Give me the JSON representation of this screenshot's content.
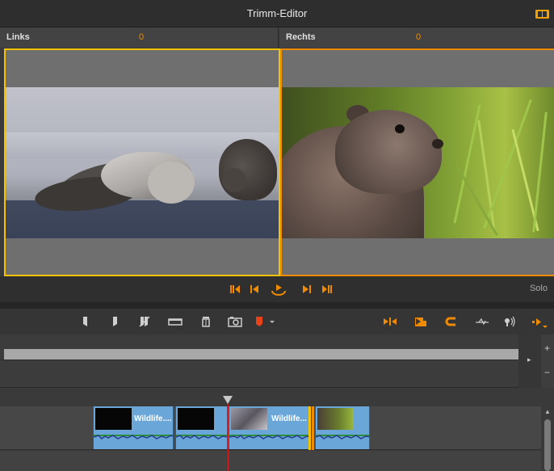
{
  "window": {
    "title": "Trimm-Editor"
  },
  "left_panel": {
    "label": "Links",
    "value": "0"
  },
  "right_panel": {
    "label": "Rechts",
    "value": "0"
  },
  "transport": {
    "solo_label": "Solo"
  },
  "timeline": {
    "clips": [
      {
        "name": "Wildlife...."
      },
      {
        "name": ""
      },
      {
        "name": "Wildlife..."
      },
      {
        "name": ""
      }
    ]
  },
  "scrubber": {
    "plus": "+",
    "minus": "−",
    "arrow": "▸"
  },
  "colors": {
    "accent_orange": "#f08a00",
    "accent_yellow": "#f7c200",
    "clip_blue": "#6aa7d8",
    "playhead_red": "#e02020"
  },
  "icons": {
    "transport": [
      "skip-to-start-icon",
      "step-back-icon",
      "loop-play-icon",
      "step-forward-icon",
      "skip-to-end-icon"
    ],
    "toolbar_left": [
      "mark-in-icon",
      "mark-out-icon",
      "clear-marks-icon",
      "storyboard-icon",
      "delete-icon",
      "snapshot-icon",
      "marker-icon",
      "marker-dropdown-icon"
    ],
    "toolbar_right": [
      "trim-mode-icon",
      "insert-icon",
      "magnet-icon",
      "audio-scrub-icon",
      "volume-icon",
      "more-icon"
    ]
  }
}
